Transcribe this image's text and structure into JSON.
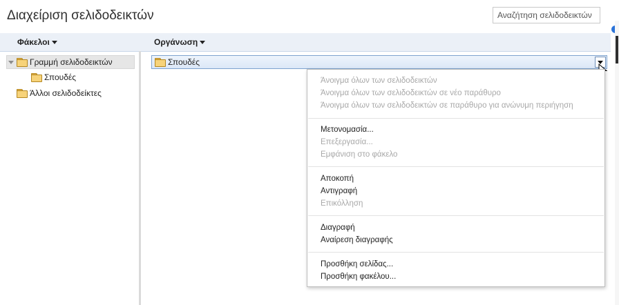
{
  "header": {
    "title": "Διαχείριση σελιδοδεικτών",
    "search_placeholder": "Αναζήτηση σελιδοδεικτών"
  },
  "columns": {
    "folders_label": "Φάκελοι",
    "organize_label": "Οργάνωση"
  },
  "tree": {
    "bookmarks_bar": "Γραμμή σελιδοδεικτών",
    "child": "Σπουδές",
    "other": "Άλλοι σελιδοδείκτες"
  },
  "list": {
    "rows": [
      {
        "label": "Σπουδές",
        "type": "folder",
        "selected": true
      }
    ]
  },
  "context_menu": {
    "groups": [
      [
        {
          "label": "Άνοιγμα όλων των σελιδοδεικτών",
          "enabled": false
        },
        {
          "label": "Άνοιγμα όλων των σελιδοδεικτών σε νέο παράθυρο",
          "enabled": false
        },
        {
          "label": "Άνοιγμα όλων των σελιδοδεικτών σε παράθυρο για ανώνυμη περιήγηση",
          "enabled": false
        }
      ],
      [
        {
          "label": "Μετονομασία...",
          "enabled": true
        },
        {
          "label": "Επεξεργασία...",
          "enabled": false
        },
        {
          "label": "Εμφάνιση στο φάκελο",
          "enabled": false
        }
      ],
      [
        {
          "label": "Αποκοπή",
          "enabled": true
        },
        {
          "label": "Αντιγραφή",
          "enabled": true
        },
        {
          "label": "Επικόλληση",
          "enabled": false
        }
      ],
      [
        {
          "label": "Διαγραφή",
          "enabled": true
        },
        {
          "label": "Αναίρεση διαγραφής",
          "enabled": true
        }
      ],
      [
        {
          "label": "Προσθήκη σελίδας...",
          "enabled": true
        },
        {
          "label": "Προσθήκη φακέλου...",
          "enabled": true
        }
      ]
    ]
  },
  "icons": {
    "folder": "folder-icon",
    "caret": "caret-down-icon",
    "expander": "tree-expander-icon",
    "cursor": "mouse-cursor-icon"
  },
  "colors": {
    "folder": "#f7d37a",
    "selection": "#dbe7f7",
    "accent": "#2a73d9",
    "disabled_text": "#a8a8a8"
  }
}
